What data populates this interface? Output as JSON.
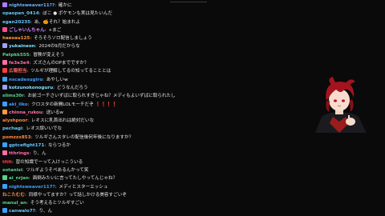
{
  "chat": {
    "messages": [
      {
        "badge": "pencil-icon",
        "badge_color": "#b07cff",
        "name": "nightsweaver11??",
        "name_color": "#6cb4ff",
        "text": "確かに"
      },
      {
        "badge": "",
        "badge_color": "",
        "name": "opaopen_0414",
        "name_color": "#63c8ff",
        "text": "ぼこ ● ポケモンも実は見たいんだ"
      },
      {
        "badge": "",
        "badge_color": "",
        "name": "egan20235",
        "name_color": "#63c8ff",
        "text": "あ、🍊それ？始まれよ"
      },
      {
        "badge": "heart-icon",
        "badge_color": "#ff4d8d",
        "name": "ごしゃいんちゃん",
        "name_color": "#d68cff",
        "text": "+まご"
      },
      {
        "badge": "",
        "badge_color": "",
        "name": "haesau125",
        "name_color": "#ff9a3d",
        "text": "そろそろソロ配信しましょう"
      },
      {
        "badge": "sword-icon",
        "badge_color": "#9aa4ff",
        "name": "yukaineon",
        "name_color": "#7ee0ff",
        "text": "2024の9月だからな"
      },
      {
        "badge": "",
        "badge_color": "",
        "name": "Patpkk555",
        "name_color": "#59d28a",
        "text": "冒険が変えそう"
      },
      {
        "badge": "sword-icon",
        "badge_color": "#ff6fa6",
        "name": "fe3e3e4",
        "name_color": "#ff6fa6",
        "text": "ズズさんのOPまでですか？"
      },
      {
        "badge": "crown-icon",
        "badge_color": "#ff4040",
        "name": "広報担当",
        "name_color": "#ff6464",
        "text": "ツルギが理解してるの知ってることとは"
      },
      {
        "badge": "star-icon",
        "badge_color": "#3aa0ff",
        "name": "nscadesugiro",
        "name_color": "#3aa0ff",
        "text": "あやしいw"
      },
      {
        "badge": "sword-icon",
        "badge_color": "#9aa4ff",
        "name": "kotzunokonoguru",
        "name_color": "#7ee0ff",
        "text": "どうなんだろう"
      },
      {
        "badge": "",
        "badge_color": "",
        "name": "slims30r",
        "name_color": "#59d28a",
        "text": "お前ゴーチさいずばに取られすぎじゃね？メディもよいずばに取られたし"
      },
      {
        "badge": "star-icon",
        "badge_color": "#3aa0ff",
        "name": "aki_ilko",
        "name_color": "#3aa0ff",
        "text": "クロスタの新開LOLモーチだぞ ❗❗❗❗"
      },
      {
        "badge": "gift-icon",
        "badge_color": "#ff9a3d",
        "name": "chinna_rukou",
        "name_color": "#ff6fa6",
        "text": "送いるw"
      },
      {
        "badge": "",
        "badge_color": "",
        "name": "alyshpoor",
        "name_color": "#ff8a3d",
        "text": "レオスに乳首出れは絶対だいな"
      },
      {
        "badge": "",
        "badge_color": "",
        "name": "pechagi",
        "name_color": "#63c8ff",
        "text": "レオス誤いいでな"
      },
      {
        "badge": "",
        "badge_color": "",
        "name": "pomzzx853",
        "name_color": "#ff8a3d",
        "text": "ツルギさんスタレの配信後何年後になりますか？"
      },
      {
        "badge": "star-icon",
        "badge_color": "#3aa0ff",
        "name": "gptcefight171",
        "name_color": "#63c8ff",
        "text": "ならつるか"
      },
      {
        "badge": "sword-icon",
        "badge_color": "#ff6fa6",
        "name": "tthrings",
        "name_color": "#ff6fa6",
        "text": "り、ん"
      },
      {
        "badge": "",
        "badge_color": "",
        "name": "tltlt",
        "name_color": "#ff4040",
        "text": "習の知識でーって入けっこういる"
      },
      {
        "badge": "",
        "badge_color": "",
        "name": "sotanisi",
        "name_color": "#59d28a",
        "text": "ツルギようそぺあるんかって笑"
      },
      {
        "badge": "sword-icon",
        "badge_color": "#59d28a",
        "name": "ai_nrjan",
        "name_color": "#59d28a",
        "text": "面倒みたいに言ってたしやってんじゃね？"
      },
      {
        "badge": "star-icon",
        "badge_color": "#3aa0ff",
        "name": "nightsweaver117?",
        "name_color": "#3aa0ff",
        "text": "メディとスターエッシュ"
      },
      {
        "badge": "",
        "badge_color": "",
        "name": "ねこたむむ",
        "name_color": "#ff8a3d",
        "text": "同様やってますか？って話しかける美容すごいぞ"
      },
      {
        "badge": "",
        "badge_color": "",
        "name": "manul_an",
        "name_color": "#59d28a",
        "text": "そう考えるとツルギすごい"
      },
      {
        "badge": "star-icon",
        "badge_color": "#3aa0ff",
        "name": "canwalo7?",
        "name_color": "#63c8ff",
        "text": "り、ん"
      }
    ]
  },
  "colors": {
    "background": "#0a0a0a",
    "text": "#e6e6e6"
  }
}
